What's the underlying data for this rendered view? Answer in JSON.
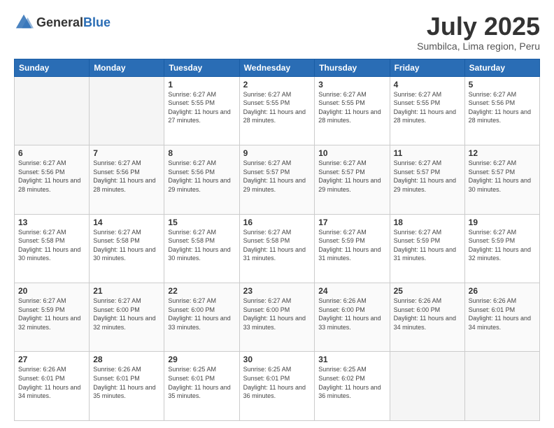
{
  "header": {
    "logo_general": "General",
    "logo_blue": "Blue",
    "title": "July 2025",
    "subtitle": "Sumbilca, Lima region, Peru"
  },
  "columns": [
    "Sunday",
    "Monday",
    "Tuesday",
    "Wednesday",
    "Thursday",
    "Friday",
    "Saturday"
  ],
  "weeks": [
    [
      {
        "day": "",
        "sunrise": "",
        "sunset": "",
        "daylight": "",
        "empty": true
      },
      {
        "day": "",
        "sunrise": "",
        "sunset": "",
        "daylight": "",
        "empty": true
      },
      {
        "day": "1",
        "sunrise": "Sunrise: 6:27 AM",
        "sunset": "Sunset: 5:55 PM",
        "daylight": "Daylight: 11 hours and 27 minutes.",
        "empty": false
      },
      {
        "day": "2",
        "sunrise": "Sunrise: 6:27 AM",
        "sunset": "Sunset: 5:55 PM",
        "daylight": "Daylight: 11 hours and 28 minutes.",
        "empty": false
      },
      {
        "day": "3",
        "sunrise": "Sunrise: 6:27 AM",
        "sunset": "Sunset: 5:55 PM",
        "daylight": "Daylight: 11 hours and 28 minutes.",
        "empty": false
      },
      {
        "day": "4",
        "sunrise": "Sunrise: 6:27 AM",
        "sunset": "Sunset: 5:55 PM",
        "daylight": "Daylight: 11 hours and 28 minutes.",
        "empty": false
      },
      {
        "day": "5",
        "sunrise": "Sunrise: 6:27 AM",
        "sunset": "Sunset: 5:56 PM",
        "daylight": "Daylight: 11 hours and 28 minutes.",
        "empty": false
      }
    ],
    [
      {
        "day": "6",
        "sunrise": "Sunrise: 6:27 AM",
        "sunset": "Sunset: 5:56 PM",
        "daylight": "Daylight: 11 hours and 28 minutes.",
        "empty": false
      },
      {
        "day": "7",
        "sunrise": "Sunrise: 6:27 AM",
        "sunset": "Sunset: 5:56 PM",
        "daylight": "Daylight: 11 hours and 28 minutes.",
        "empty": false
      },
      {
        "day": "8",
        "sunrise": "Sunrise: 6:27 AM",
        "sunset": "Sunset: 5:56 PM",
        "daylight": "Daylight: 11 hours and 29 minutes.",
        "empty": false
      },
      {
        "day": "9",
        "sunrise": "Sunrise: 6:27 AM",
        "sunset": "Sunset: 5:57 PM",
        "daylight": "Daylight: 11 hours and 29 minutes.",
        "empty": false
      },
      {
        "day": "10",
        "sunrise": "Sunrise: 6:27 AM",
        "sunset": "Sunset: 5:57 PM",
        "daylight": "Daylight: 11 hours and 29 minutes.",
        "empty": false
      },
      {
        "day": "11",
        "sunrise": "Sunrise: 6:27 AM",
        "sunset": "Sunset: 5:57 PM",
        "daylight": "Daylight: 11 hours and 29 minutes.",
        "empty": false
      },
      {
        "day": "12",
        "sunrise": "Sunrise: 6:27 AM",
        "sunset": "Sunset: 5:57 PM",
        "daylight": "Daylight: 11 hours and 30 minutes.",
        "empty": false
      }
    ],
    [
      {
        "day": "13",
        "sunrise": "Sunrise: 6:27 AM",
        "sunset": "Sunset: 5:58 PM",
        "daylight": "Daylight: 11 hours and 30 minutes.",
        "empty": false
      },
      {
        "day": "14",
        "sunrise": "Sunrise: 6:27 AM",
        "sunset": "Sunset: 5:58 PM",
        "daylight": "Daylight: 11 hours and 30 minutes.",
        "empty": false
      },
      {
        "day": "15",
        "sunrise": "Sunrise: 6:27 AM",
        "sunset": "Sunset: 5:58 PM",
        "daylight": "Daylight: 11 hours and 30 minutes.",
        "empty": false
      },
      {
        "day": "16",
        "sunrise": "Sunrise: 6:27 AM",
        "sunset": "Sunset: 5:58 PM",
        "daylight": "Daylight: 11 hours and 31 minutes.",
        "empty": false
      },
      {
        "day": "17",
        "sunrise": "Sunrise: 6:27 AM",
        "sunset": "Sunset: 5:59 PM",
        "daylight": "Daylight: 11 hours and 31 minutes.",
        "empty": false
      },
      {
        "day": "18",
        "sunrise": "Sunrise: 6:27 AM",
        "sunset": "Sunset: 5:59 PM",
        "daylight": "Daylight: 11 hours and 31 minutes.",
        "empty": false
      },
      {
        "day": "19",
        "sunrise": "Sunrise: 6:27 AM",
        "sunset": "Sunset: 5:59 PM",
        "daylight": "Daylight: 11 hours and 32 minutes.",
        "empty": false
      }
    ],
    [
      {
        "day": "20",
        "sunrise": "Sunrise: 6:27 AM",
        "sunset": "Sunset: 5:59 PM",
        "daylight": "Daylight: 11 hours and 32 minutes.",
        "empty": false
      },
      {
        "day": "21",
        "sunrise": "Sunrise: 6:27 AM",
        "sunset": "Sunset: 6:00 PM",
        "daylight": "Daylight: 11 hours and 32 minutes.",
        "empty": false
      },
      {
        "day": "22",
        "sunrise": "Sunrise: 6:27 AM",
        "sunset": "Sunset: 6:00 PM",
        "daylight": "Daylight: 11 hours and 33 minutes.",
        "empty": false
      },
      {
        "day": "23",
        "sunrise": "Sunrise: 6:27 AM",
        "sunset": "Sunset: 6:00 PM",
        "daylight": "Daylight: 11 hours and 33 minutes.",
        "empty": false
      },
      {
        "day": "24",
        "sunrise": "Sunrise: 6:26 AM",
        "sunset": "Sunset: 6:00 PM",
        "daylight": "Daylight: 11 hours and 33 minutes.",
        "empty": false
      },
      {
        "day": "25",
        "sunrise": "Sunrise: 6:26 AM",
        "sunset": "Sunset: 6:00 PM",
        "daylight": "Daylight: 11 hours and 34 minutes.",
        "empty": false
      },
      {
        "day": "26",
        "sunrise": "Sunrise: 6:26 AM",
        "sunset": "Sunset: 6:01 PM",
        "daylight": "Daylight: 11 hours and 34 minutes.",
        "empty": false
      }
    ],
    [
      {
        "day": "27",
        "sunrise": "Sunrise: 6:26 AM",
        "sunset": "Sunset: 6:01 PM",
        "daylight": "Daylight: 11 hours and 34 minutes.",
        "empty": false
      },
      {
        "day": "28",
        "sunrise": "Sunrise: 6:26 AM",
        "sunset": "Sunset: 6:01 PM",
        "daylight": "Daylight: 11 hours and 35 minutes.",
        "empty": false
      },
      {
        "day": "29",
        "sunrise": "Sunrise: 6:25 AM",
        "sunset": "Sunset: 6:01 PM",
        "daylight": "Daylight: 11 hours and 35 minutes.",
        "empty": false
      },
      {
        "day": "30",
        "sunrise": "Sunrise: 6:25 AM",
        "sunset": "Sunset: 6:01 PM",
        "daylight": "Daylight: 11 hours and 36 minutes.",
        "empty": false
      },
      {
        "day": "31",
        "sunrise": "Sunrise: 6:25 AM",
        "sunset": "Sunset: 6:02 PM",
        "daylight": "Daylight: 11 hours and 36 minutes.",
        "empty": false
      },
      {
        "day": "",
        "sunrise": "",
        "sunset": "",
        "daylight": "",
        "empty": true
      },
      {
        "day": "",
        "sunrise": "",
        "sunset": "",
        "daylight": "",
        "empty": true
      }
    ]
  ]
}
